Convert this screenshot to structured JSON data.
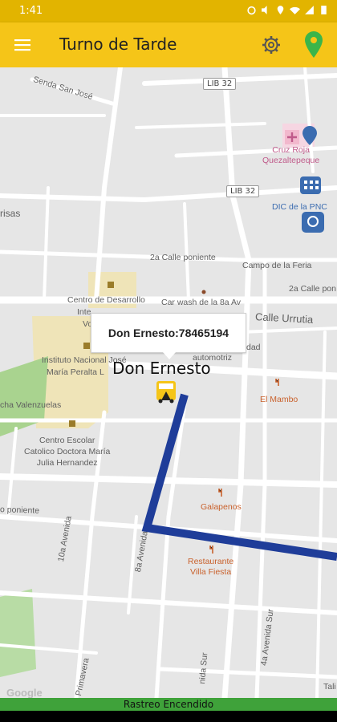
{
  "status_bar": {
    "time": "1:41"
  },
  "app": {
    "title": "Turno de Tarde"
  },
  "map": {
    "streets": {
      "senda_san_jose": "Senda San José",
      "segunda_calle_poniente": "2a Calle poniente",
      "segunda_calle_poniente_right": "2a Calle pon",
      "calle_urrutia": "Calle Urrutia",
      "poniente": "o poniente",
      "decima_avenida": "10a Avenida",
      "octava_avenida": "8a Avenida",
      "cuarta_avenida_sur": "4a Avenida Sur",
      "avenida_sur": "nida Sur",
      "primavera": "Primavera",
      "tali": "Tali"
    },
    "shields": {
      "lib32_top": "LIB 32",
      "lib32_mid": "LIB 32"
    },
    "places": {
      "cruz_roja": "Cruz Roja\nQuezaltepeque",
      "dic_pnc": "DIC de la PNC",
      "campo_feria": "Campo de la Feria",
      "carwash": "Car wash de la 8a Av",
      "centro_desarrollo": "Centro de Desarrollo",
      "centro_desarrollo_2": "Inte",
      "centro_desarrollo_3": "Vo",
      "instituto": "Instituto Nacional José",
      "instituto_2": "María Peralta L",
      "cancha": "cha Valenzuelas",
      "centro_escolar": "Centro Escolar\nCatolico Doctora María\nJulia Hernandez",
      "el_mambo": "El Mambo",
      "galapenos": "Galapenos",
      "restaurante": "Restaurante\nVilla Fiesta",
      "automotriz": "automotriz",
      "dad": "dad",
      "risas": "risas"
    },
    "popup": {
      "text": "Don Ernesto:78465194"
    },
    "bus_label": "Don Ernesto",
    "route_color": "#1f3d99",
    "attribution": "Google"
  },
  "footer": {
    "status": "Rastreo Encendido"
  },
  "colors": {
    "toolbar": "#f5c518",
    "status_bar": "#e2b400",
    "footer": "#3fa23a",
    "pin": "#3bb54a"
  }
}
